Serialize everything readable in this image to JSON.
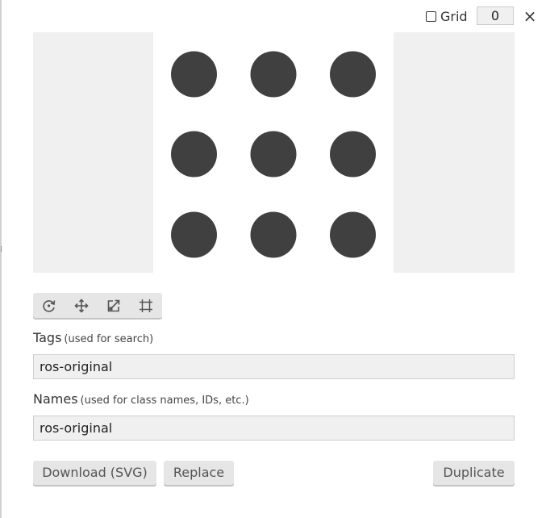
{
  "grid": {
    "label": "Grid",
    "checked": false,
    "value": "0"
  },
  "close": {
    "glyph": "×"
  },
  "preview": {
    "icon_name": "ros-original",
    "dot_color": "#404040",
    "canvas_color": "#ffffff",
    "backdrop_color": "#f0f0f0"
  },
  "toolbar": {
    "tools": [
      {
        "name": "rotate-icon"
      },
      {
        "name": "move-icon"
      },
      {
        "name": "scale-icon"
      },
      {
        "name": "crop-icon"
      }
    ]
  },
  "tags": {
    "label": "Tags",
    "hint": "(used for search)",
    "value": "ros-original"
  },
  "names": {
    "label": "Names",
    "hint": "(used for class names, IDs, etc.)",
    "value": "ros-original"
  },
  "buttons": {
    "download": "Download (SVG)",
    "replace": "Replace",
    "duplicate": "Duplicate"
  }
}
